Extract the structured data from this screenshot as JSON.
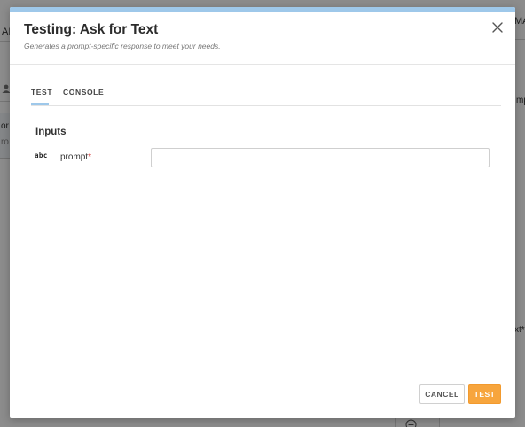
{
  "background": {
    "frag_top_left": "AI",
    "frag_top_right": "MA",
    "frag_left_1": "or",
    "frag_left_2": "ro",
    "frag_right_mid": "mp",
    "frag_right_low": "xt*"
  },
  "modal": {
    "title": "Testing: Ask for Text",
    "subtitle": "Generates a prompt-specific response to meet your needs."
  },
  "tabs": [
    {
      "label": "TEST",
      "active": true
    },
    {
      "label": "CONSOLE",
      "active": false
    }
  ],
  "inputs": {
    "heading": "Inputs",
    "fields": [
      {
        "type_icon": "abc",
        "label": "prompt",
        "required_mark": "*",
        "value": "",
        "placeholder": ""
      }
    ]
  },
  "footer": {
    "cancel_label": "CANCEL",
    "test_label": "TEST"
  },
  "colors": {
    "accent": "#9ec8ea",
    "primary_button": "#f7a53d",
    "required": "#d23030"
  }
}
